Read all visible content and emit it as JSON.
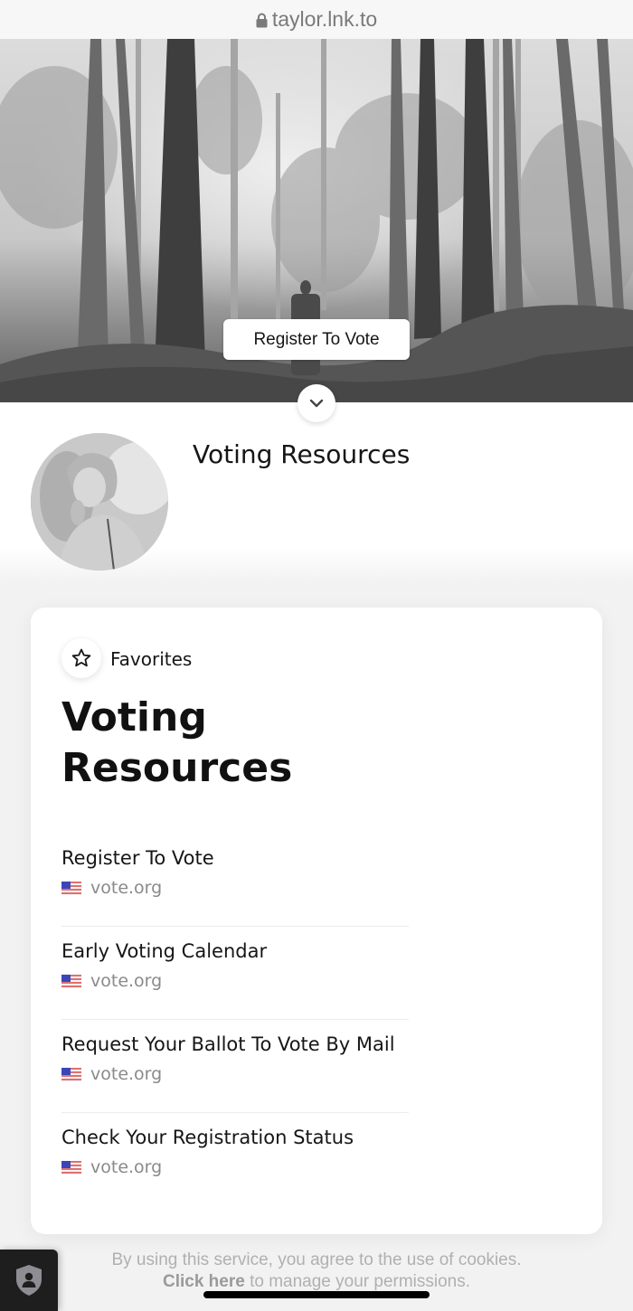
{
  "browser": {
    "url": "taylor.lnk.to",
    "lock_icon": "lock-icon"
  },
  "hero": {
    "cta_label": "Register To Vote",
    "image_description": "black-and-white misty forest with a figure standing among trees",
    "scroll_icon": "chevron-down-icon"
  },
  "profile": {
    "title": "Voting Resources",
    "avatar_description": "black-and-white portrait photo"
  },
  "card": {
    "favorites_icon": "star-icon",
    "favorites_label": "Favorites",
    "title": "Voting Resources",
    "links": [
      {
        "title": "Register To Vote",
        "domain": "vote.org",
        "icon": "us-flag-icon"
      },
      {
        "title": "Early Voting Calendar",
        "domain": "vote.org",
        "icon": "us-flag-icon"
      },
      {
        "title": "Request Your Ballot To Vote By Mail",
        "domain": "vote.org",
        "icon": "us-flag-icon"
      },
      {
        "title": "Check Your Registration Status",
        "domain": "vote.org",
        "icon": "us-flag-icon"
      }
    ]
  },
  "cookie": {
    "line1": "By using this service, you agree to the use of cookies.",
    "link_label": "Click here",
    "line2_rest": " to manage your permissions.",
    "privacy_icon": "privacy-shield-icon"
  }
}
